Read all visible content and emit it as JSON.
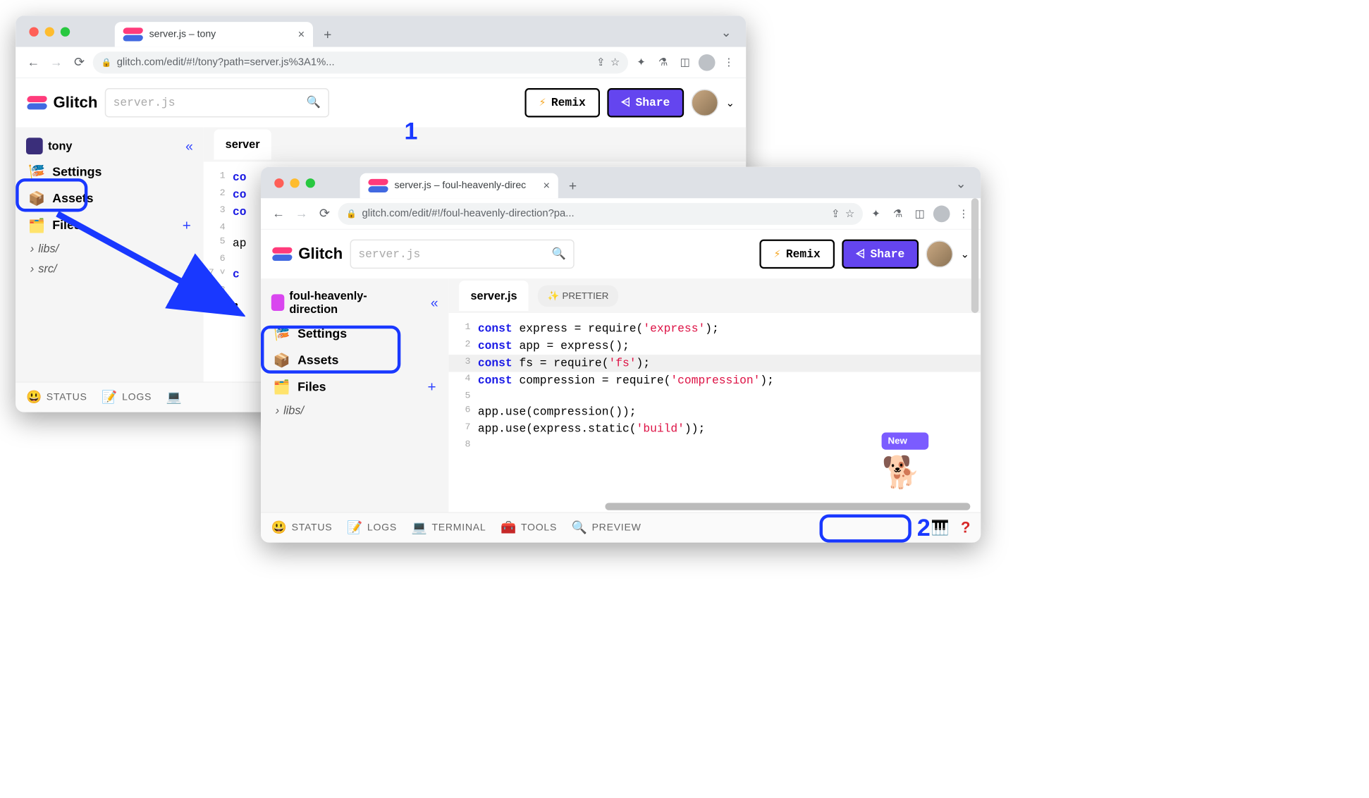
{
  "annotations": {
    "one": "1",
    "two": "2"
  },
  "window1": {
    "tab_title": "server.js – tony",
    "url": "glitch.com/edit/#!/tony?path=server.js%3A1%...",
    "glitch_brand": "Glitch",
    "search_placeholder": "server.js",
    "remix_label": "Remix",
    "share_label": "Share",
    "project_name": "tony",
    "sidebar": {
      "settings": "Settings",
      "assets": "Assets",
      "files": "Files",
      "folders": [
        "libs/",
        "src/"
      ]
    },
    "editor_tab": "server",
    "code_prefix": [
      "co",
      "co",
      "co",
      "",
      "ap",
      "",
      "c",
      "",
      ""
    ],
    "bottom": {
      "status": "STATUS",
      "logs": "LOGS"
    }
  },
  "window2": {
    "tab_title": "server.js – foul-heavenly-direc",
    "url": "glitch.com/edit/#!/foul-heavenly-direction?pa...",
    "glitch_brand": "Glitch",
    "search_placeholder": "server.js",
    "remix_label": "Remix",
    "share_label": "Share",
    "project_name": "foul-heavenly-direction",
    "sidebar": {
      "settings": "Settings",
      "assets": "Assets",
      "files": "Files",
      "folders": [
        "libs/"
      ]
    },
    "editor_tab": "server.js",
    "prettier_label": "PRETTIER",
    "code": [
      {
        "n": "1",
        "kw": "const",
        "rest": " express = require(",
        "str": "'express'",
        "tail": ");"
      },
      {
        "n": "2",
        "kw": "const",
        "rest": " app = express();",
        "str": "",
        "tail": ""
      },
      {
        "n": "3",
        "kw": "const",
        "rest": " fs = require(",
        "str": "'fs'",
        "tail": ");"
      },
      {
        "n": "4",
        "kw": "const",
        "rest": " compression = require(",
        "str": "'compression'",
        "tail": ");"
      },
      {
        "n": "5",
        "kw": "",
        "rest": "",
        "str": "",
        "tail": ""
      },
      {
        "n": "6",
        "kw": "",
        "rest": "app.use(compression());",
        "str": "",
        "tail": ""
      },
      {
        "n": "7",
        "kw": "",
        "rest": "app.use(express.static(",
        "str": "'build'",
        "tail": "));"
      },
      {
        "n": "8",
        "kw": "",
        "rest": "",
        "str": "",
        "tail": ""
      }
    ],
    "bottom": {
      "status": "STATUS",
      "logs": "LOGS",
      "terminal": "TERMINAL",
      "tools": "TOOLS",
      "preview": "PREVIEW"
    },
    "new_badge": "New"
  }
}
